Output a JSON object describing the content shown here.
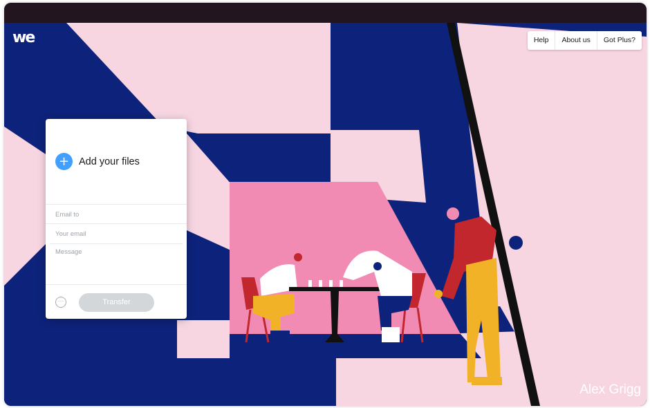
{
  "header": {
    "logo_text": "we"
  },
  "nav": {
    "help": "Help",
    "about": "About us",
    "plus": "Got Plus?"
  },
  "panel": {
    "add_files_label": "Add your files",
    "plus_icon": "+",
    "email_to_placeholder": "Email to",
    "your_email_placeholder": "Your email",
    "message_placeholder": "Message",
    "options_icon": "···",
    "transfer_label": "Transfer"
  },
  "credit": {
    "artist": "Alex Grigg"
  },
  "colors": {
    "navy": "#0d227a",
    "pink_light": "#f7d6e2",
    "pink_hot": "#f28bb4",
    "red": "#c1272d",
    "yellow": "#f2b227",
    "accent_blue": "#409fff"
  }
}
